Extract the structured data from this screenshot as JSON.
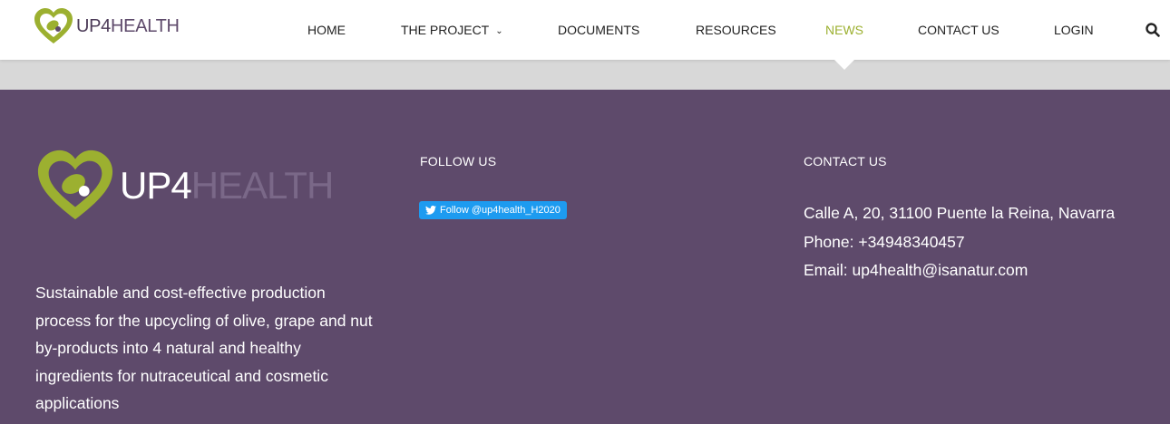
{
  "brand": {
    "logo_up": "UP4",
    "logo_health": "HEALTH",
    "colors": {
      "purple": "#5e4a6b",
      "green": "#9cb030",
      "twitter": "#1d9bf0"
    }
  },
  "nav": {
    "items": [
      {
        "label": "HOME"
      },
      {
        "label": "THE PROJECT",
        "has_dropdown": true
      },
      {
        "label": "DOCUMENTS"
      },
      {
        "label": "RESOURCES"
      },
      {
        "label": "NEWS",
        "active": true
      },
      {
        "label": "CONTACT US"
      },
      {
        "label": "LOGIN"
      }
    ],
    "search_icon": "search-icon"
  },
  "footer": {
    "description": "Sustainable and cost-effective production process for the upcycling of olive, grape and nut by-products into 4 natural and healthy ingredients for nutraceutical and cosmetic applications",
    "follow": {
      "heading": "FOLLOW US",
      "twitter_label": "Follow @up4health_H2020"
    },
    "contact": {
      "heading": "CONTACT US",
      "address": "Calle A, 20, 31100 Puente la Reina, Navarra",
      "phone_label": "Phone:",
      "phone": "+34948340457",
      "email_label": "Email:",
      "email": "up4health@isanatur.com"
    }
  }
}
